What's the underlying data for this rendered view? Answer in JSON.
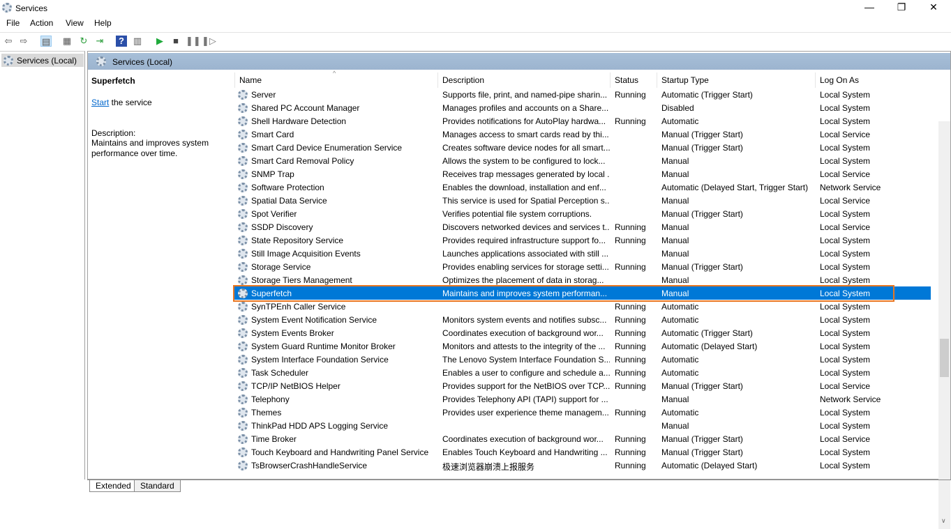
{
  "window": {
    "title": "Services",
    "minimize": "—",
    "restore": "❐",
    "close": "✕"
  },
  "menu": [
    "File",
    "Action",
    "View",
    "Help"
  ],
  "toolbar_icons": [
    "back-icon",
    "forward-icon",
    "console-tree-icon",
    "properties-icon",
    "refresh-icon",
    "export-icon",
    "help-icon",
    "view-icon",
    "start-icon",
    "stop-icon",
    "pause-icon",
    "resume-icon"
  ],
  "tree": {
    "item": "Services (Local)"
  },
  "banner": {
    "title": "Services (Local)"
  },
  "detail": {
    "name": "Superfetch",
    "start_link": "Start",
    "start_rest": " the service",
    "desc_label": "Description:",
    "desc": "Maintains and improves system performance over time."
  },
  "columns": [
    "Name",
    "Description",
    "Status",
    "Startup Type",
    "Log On As"
  ],
  "rows": [
    [
      "Server",
      "Supports file, print, and named-pipe sharin...",
      "Running",
      "Automatic (Trigger Start)",
      "Local System"
    ],
    [
      "Shared PC Account Manager",
      "Manages profiles and accounts on a Share...",
      "",
      "Disabled",
      "Local System"
    ],
    [
      "Shell Hardware Detection",
      "Provides notifications for AutoPlay hardwa...",
      "Running",
      "Automatic",
      "Local System"
    ],
    [
      "Smart Card",
      "Manages access to smart cards read by thi...",
      "",
      "Manual (Trigger Start)",
      "Local Service"
    ],
    [
      "Smart Card Device Enumeration Service",
      "Creates software device nodes for all smart...",
      "",
      "Manual (Trigger Start)",
      "Local System"
    ],
    [
      "Smart Card Removal Policy",
      "Allows the system to be configured to lock...",
      "",
      "Manual",
      "Local System"
    ],
    [
      "SNMP Trap",
      "Receives trap messages generated by local ...",
      "",
      "Manual",
      "Local Service"
    ],
    [
      "Software Protection",
      "Enables the download, installation and enf...",
      "",
      "Automatic (Delayed Start, Trigger Start)",
      "Network Service"
    ],
    [
      "Spatial Data Service",
      "This service is used for Spatial Perception s...",
      "",
      "Manual",
      "Local Service"
    ],
    [
      "Spot Verifier",
      "Verifies potential file system corruptions.",
      "",
      "Manual (Trigger Start)",
      "Local System"
    ],
    [
      "SSDP Discovery",
      "Discovers networked devices and services t...",
      "Running",
      "Manual",
      "Local Service"
    ],
    [
      "State Repository Service",
      "Provides required infrastructure support fo...",
      "Running",
      "Manual",
      "Local System"
    ],
    [
      "Still Image Acquisition Events",
      "Launches applications associated with still ...",
      "",
      "Manual",
      "Local System"
    ],
    [
      "Storage Service",
      "Provides enabling services for storage setti...",
      "Running",
      "Manual (Trigger Start)",
      "Local System"
    ],
    [
      "Storage Tiers Management",
      "Optimizes the placement of data in storag...",
      "",
      "Manual",
      "Local System"
    ],
    [
      "Superfetch",
      "Maintains and improves system performan...",
      "",
      "Manual",
      "Local System"
    ],
    [
      "SynTPEnh Caller Service",
      "",
      "Running",
      "Automatic",
      "Local System"
    ],
    [
      "System Event Notification Service",
      "Monitors system events and notifies subsc...",
      "Running",
      "Automatic",
      "Local System"
    ],
    [
      "System Events Broker",
      "Coordinates execution of background wor...",
      "Running",
      "Automatic (Trigger Start)",
      "Local System"
    ],
    [
      "System Guard Runtime Monitor Broker",
      "Monitors and attests to the integrity of the ...",
      "Running",
      "Automatic (Delayed Start)",
      "Local System"
    ],
    [
      "System Interface Foundation Service",
      "The Lenovo System Interface Foundation S...",
      "Running",
      "Automatic",
      "Local System"
    ],
    [
      "Task Scheduler",
      "Enables a user to configure and schedule a...",
      "Running",
      "Automatic",
      "Local System"
    ],
    [
      "TCP/IP NetBIOS Helper",
      "Provides support for the NetBIOS over TCP...",
      "Running",
      "Manual (Trigger Start)",
      "Local Service"
    ],
    [
      "Telephony",
      "Provides Telephony API (TAPI) support for ...",
      "",
      "Manual",
      "Network Service"
    ],
    [
      "Themes",
      "Provides user experience theme managem...",
      "Running",
      "Automatic",
      "Local System"
    ],
    [
      "ThinkPad HDD APS Logging Service",
      "",
      "",
      "Manual",
      "Local System"
    ],
    [
      "Time Broker",
      "Coordinates execution of background wor...",
      "Running",
      "Manual (Trigger Start)",
      "Local Service"
    ],
    [
      "Touch Keyboard and Handwriting Panel Service",
      "Enables Touch Keyboard and Handwriting ...",
      "Running",
      "Manual (Trigger Start)",
      "Local System"
    ],
    [
      "TsBrowserCrashHandleService",
      "极速浏览器崩溃上报服务",
      "Running",
      "Automatic (Delayed Start)",
      "Local System"
    ]
  ],
  "selected_index": 15,
  "colors": {
    "selection": "#0078d7",
    "highlight_border": "#e87722"
  },
  "tabs": [
    "Extended",
    "Standard"
  ]
}
